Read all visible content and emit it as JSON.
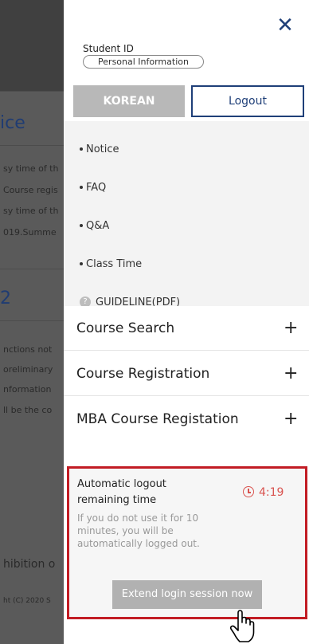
{
  "background": {
    "lines_top": [
      "sy time of th",
      "Course regis",
      "sy time of th",
      "019.Summe"
    ],
    "heading_1": "ice",
    "heading_2": "2",
    "lines_mid": [
      "nctions not",
      "oreliminary",
      "nformation",
      "ll be the co"
    ],
    "footer_text": "hibition o",
    "copyright": "ht (C) 2020 S"
  },
  "drawer": {
    "student_id_label": "Student ID",
    "personal_info_label": "Personal Information",
    "buttons": {
      "korean": "KOREAN",
      "logout": "Logout"
    },
    "submenu": [
      {
        "label": "Notice"
      },
      {
        "label": "FAQ"
      },
      {
        "label": "Q&A"
      },
      {
        "label": "Class Time"
      }
    ],
    "guideline": {
      "icon": "question-circle-icon",
      "label": "GUIDELINE(PDF)"
    },
    "menu": [
      {
        "label": "Course Search"
      },
      {
        "label": "Course Registration"
      },
      {
        "label": "MBA Course Registation"
      }
    ],
    "plus_symbol": "+",
    "close_symbol": "✕",
    "logout_box": {
      "title": "Automatic logout remaining time",
      "timer": "4:19",
      "description": "If you do not use it for 10 minutes, you will be automatically logged out.",
      "extend_label": "Extend login session now"
    }
  },
  "colors": {
    "accent_navy": "#1f3f78",
    "alert_red": "#c21c24",
    "timer_red": "#d9534f",
    "button_gray": "#b1b1b1"
  }
}
